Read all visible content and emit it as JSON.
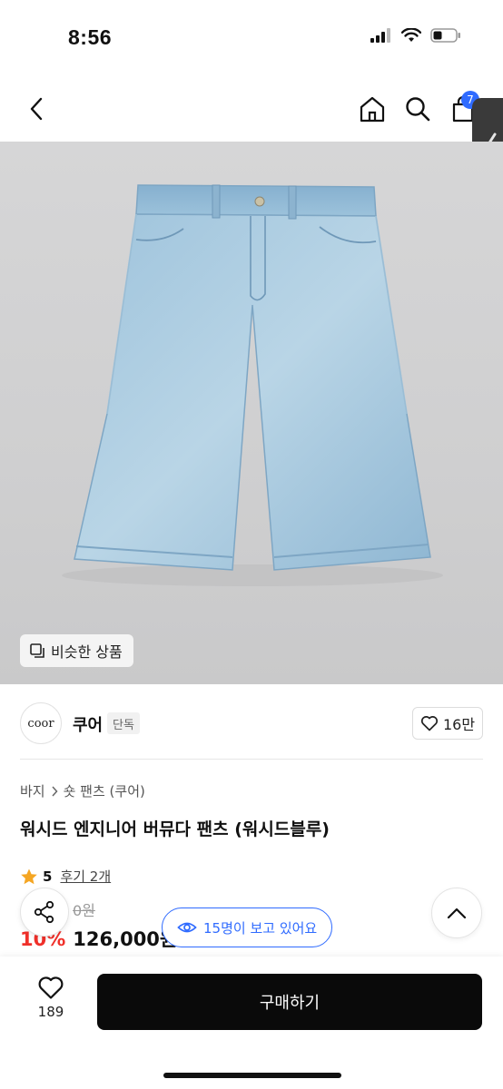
{
  "status_bar": {
    "time": "8:56"
  },
  "header": {
    "cart_count": "7"
  },
  "image": {
    "similar_label": "비슷한 상품"
  },
  "brand": {
    "logo_text": "coor",
    "name": "쿠어",
    "badge": "단독",
    "likes": "16만"
  },
  "breadcrumb": {
    "category": "바지",
    "subcategory": "숏 팬츠 (쿠어)"
  },
  "product": {
    "title": "워시드 엔지니어 버뮤다 팬츠 (워시드블루)",
    "rating": "5",
    "reviews": "후기 2개",
    "original_price": "0원",
    "discount": "10%",
    "price": "126,000원"
  },
  "viewers": {
    "text": "15명이 보고 있어요"
  },
  "bottom_bar": {
    "like_count": "189",
    "buy_label": "구매하기"
  },
  "colors": {
    "accent": "#2f6bff",
    "discount": "#f0302a",
    "buy_button": "#0a0a0a"
  }
}
